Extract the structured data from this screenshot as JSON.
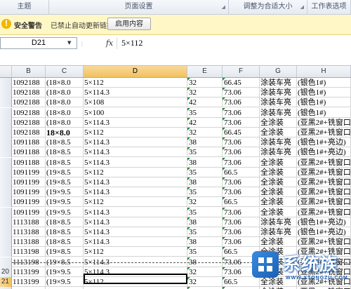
{
  "ribbon": {
    "groups": [
      "主题",
      "页面设置",
      "调整为合适大小",
      "工作表选项"
    ]
  },
  "security_bar": {
    "title": "安全警告",
    "message": "已禁止自动更新链接",
    "button": "启用内容"
  },
  "formula_bar": {
    "name_box": "D21",
    "fx": "fx",
    "formula": "5×112"
  },
  "columns": [
    "B",
    "C",
    "D",
    "E",
    "F",
    "G",
    "H"
  ],
  "selected_column": "D",
  "rows": [
    {
      "n": "",
      "cells": [
        "1092188",
        "(18×8.0",
        "5×112",
        "32",
        "66.45",
        "涂装车亮",
        "(银色1#)"
      ]
    },
    {
      "n": "",
      "cells": [
        "1092188",
        "(18×8.0",
        "5×114.3",
        "32",
        "73.06",
        "涂装车亮",
        "(银色1#)"
      ]
    },
    {
      "n": "",
      "cells": [
        "1092188",
        "(18×8.0",
        "5×108",
        "42",
        "73.06",
        "涂装车亮",
        "(银色1#)"
      ]
    },
    {
      "n": "",
      "cells": [
        "1092188",
        "(18×8.0",
        "5×100",
        "35",
        "73.06",
        "涂装车亮",
        "(银色1#)"
      ]
    },
    {
      "n": "",
      "cells": [
        "1092188",
        "(18×8.0",
        "5×114.3",
        "42",
        "73.06",
        "全涂装",
        "(亚黑2#+铣窗口)"
      ]
    },
    {
      "n": "",
      "cells": [
        "1092188",
        "18×8.0",
        "5×112",
        "32",
        "66.45",
        "全涂装",
        "(亚黑2#+铣窗口)"
      ]
    },
    {
      "n": "",
      "cells": [
        "1091188",
        "(18×8.5",
        "5×114.3",
        "38",
        "73.06",
        "涂装车亮",
        "(银色1#+亮边)"
      ]
    },
    {
      "n": "",
      "cells": [
        "1091188",
        "(18×8.5",
        "5×114.3",
        "35",
        "73.06",
        "涂装车亮",
        "(银色1#+亮边)"
      ]
    },
    {
      "n": "",
      "cells": [
        "1091188",
        "(18×8.5",
        "5×114.3",
        "38",
        "73.06",
        "全涂装",
        "(亚黑2#+铣窗口)"
      ]
    },
    {
      "n": "",
      "cells": [
        "1091199",
        "(19×8.5",
        "5×112",
        "35",
        "66.5",
        "全涂装",
        "(亚黑2#+铣窗口)"
      ]
    },
    {
      "n": "",
      "cells": [
        "1091199",
        "(19×8.5",
        "5×114.3",
        "38",
        "73.06",
        "全涂装",
        "(亚黑2#+铣窗口)"
      ]
    },
    {
      "n": "",
      "cells": [
        "1091199",
        "(19×9.5",
        "5×114.3",
        "35",
        "73.06",
        "全涂装",
        "(亚黑2#+铣窗口)"
      ]
    },
    {
      "n": "",
      "cells": [
        "1091199",
        "(19×9.5",
        "5×112",
        "32",
        "66.5",
        "全涂装",
        "(亚黑2#+铣窗口)"
      ]
    },
    {
      "n": "",
      "cells": [
        "1091199",
        "(19×9.5",
        "5×114.3",
        "35",
        "73.06",
        "全涂装",
        "(亚黑2#+铣窗口)"
      ]
    },
    {
      "n": "",
      "cells": [
        "1113188",
        "(18×8.5",
        "5×114.3",
        "38",
        "73.06",
        "涂装车亮",
        "(银色1#+亮边)"
      ]
    },
    {
      "n": "",
      "cells": [
        "1113188",
        "(18×8.5",
        "5×114.3",
        "35",
        "73.06",
        "涂装车亮",
        "(银色1#+亮边)"
      ]
    },
    {
      "n": "",
      "cells": [
        "1113188",
        "(18×8.5",
        "5×114.3",
        "38",
        "73.06",
        "全涂装",
        "(亚黑2#+铣窗口)"
      ]
    },
    {
      "n": "",
      "cells": [
        "1113198",
        "(19×8.5",
        "5×112",
        "35",
        "66.5",
        "全涂装",
        "(亚黑2#+铣窗口)"
      ]
    },
    {
      "n": "",
      "cells": [
        "1113198",
        "(19×8.5",
        "5×114.3",
        "38",
        "73.06",
        "全涂装",
        "(亚黑2#+铣窗口)"
      ]
    },
    {
      "n": "20",
      "cells": [
        "1113199",
        "(19×9.5",
        "5×114.3",
        "32",
        "73.06",
        "全涂装",
        "(亚黑2#+铣窗口)"
      ]
    },
    {
      "n": "21",
      "cells": [
        "1113199",
        "(19×9.5",
        "5×112",
        "32",
        "66.5",
        "全涂装",
        "(亚黑2#+铣窗口)"
      ]
    },
    {
      "n": "",
      "cells": [
        "1113199",
        "(19×9.5",
        "5×114.3",
        "32",
        "73.06",
        "全涂装",
        "(亚黑2#+铣窗口)"
      ]
    }
  ],
  "watermark": {
    "text": "系统族",
    "url": "WWW.XTONGZU.COM"
  },
  "colors": {
    "selection": "#f1c15f",
    "warning_bar": "#fff7c6",
    "error_triangle": "#1a8a2e"
  }
}
